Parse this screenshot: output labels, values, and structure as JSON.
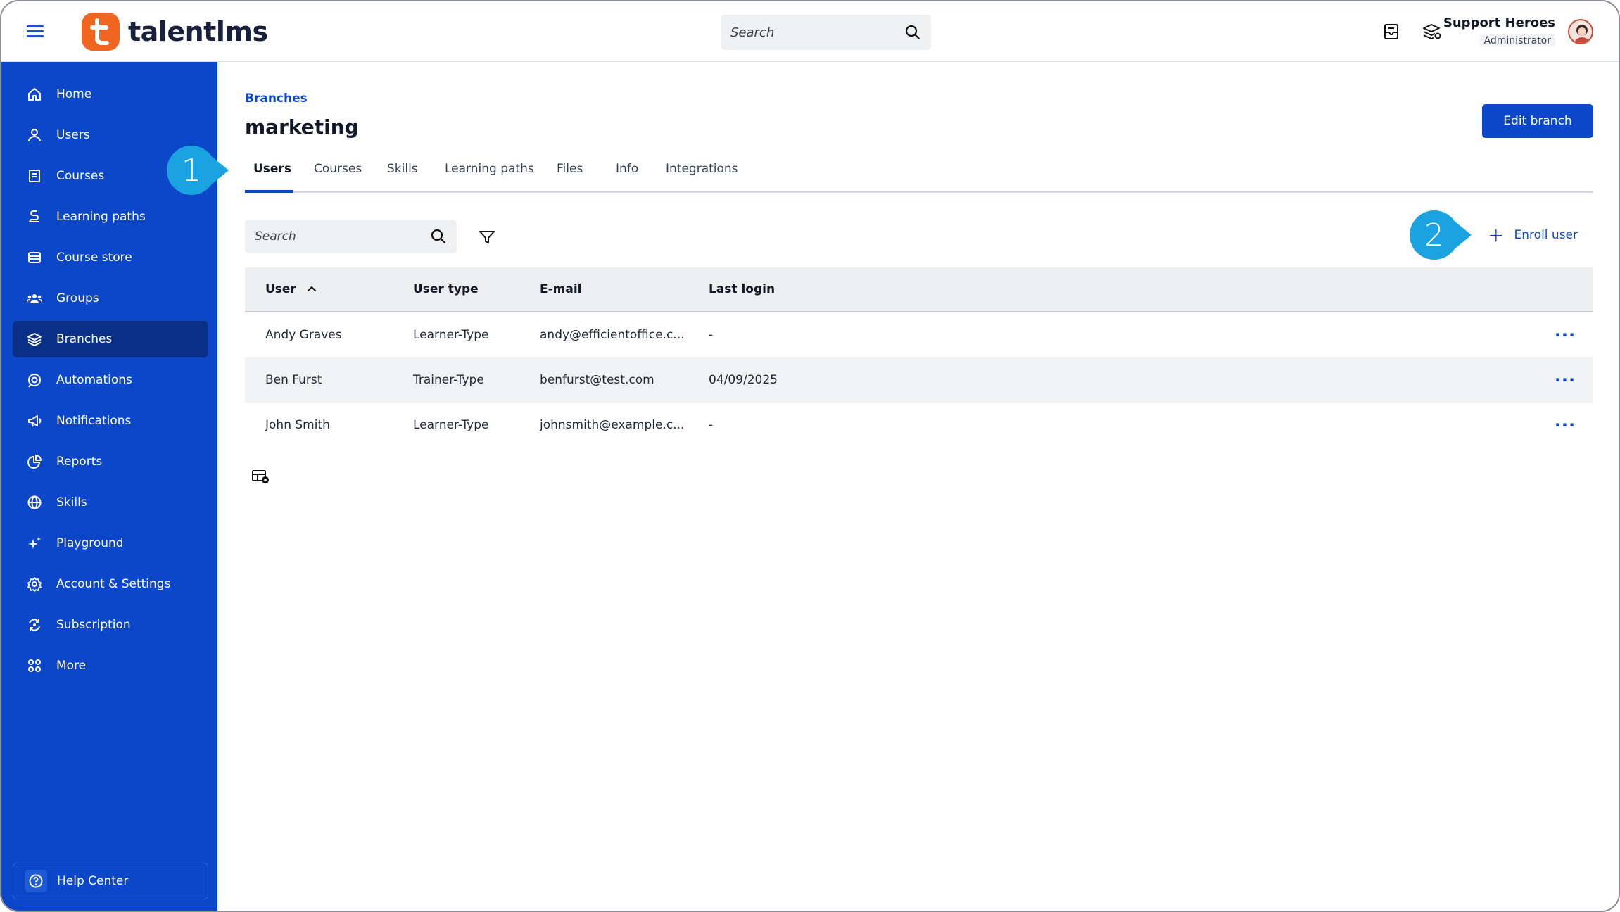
{
  "app": {
    "brand_name": "talentlms",
    "brand_color": "#f0651f",
    "accent_color": "#0d47c9"
  },
  "topbar": {
    "search_placeholder": "Search",
    "icons": [
      "menu-icon",
      "search-icon",
      "messages-icon",
      "branches-switch-icon"
    ],
    "user_name": "Support Heroes",
    "user_role": "Administrator"
  },
  "sidebar": {
    "items": [
      {
        "label": "Home",
        "icon": "home-icon"
      },
      {
        "label": "Users",
        "icon": "user-icon"
      },
      {
        "label": "Courses",
        "icon": "book-icon"
      },
      {
        "label": "Learning paths",
        "icon": "path-icon"
      },
      {
        "label": "Course store",
        "icon": "store-icon"
      },
      {
        "label": "Groups",
        "icon": "groups-icon"
      },
      {
        "label": "Branches",
        "icon": "layers-icon",
        "active": true
      },
      {
        "label": "Automations",
        "icon": "automation-icon"
      },
      {
        "label": "Notifications",
        "icon": "megaphone-icon"
      },
      {
        "label": "Reports",
        "icon": "pie-chart-icon"
      },
      {
        "label": "Skills",
        "icon": "globe-icon"
      },
      {
        "label": "Playground",
        "icon": "sparkle-icon"
      },
      {
        "label": "Account & Settings",
        "icon": "gear-icon"
      },
      {
        "label": "Subscription",
        "icon": "refresh-icon"
      },
      {
        "label": "More",
        "icon": "grid-icon"
      }
    ],
    "help_label": "Help Center"
  },
  "main": {
    "breadcrumb": "Branches",
    "title": "marketing",
    "edit_button": "Edit branch",
    "tabs": [
      "Users",
      "Courses",
      "Skills",
      "Learning paths",
      "Files",
      "Info",
      "Integrations"
    ],
    "active_tab": "Users",
    "search_placeholder": "Search",
    "enroll_label": "Enroll user",
    "callouts": [
      "1",
      "2"
    ],
    "table": {
      "columns": [
        "User",
        "User type",
        "E-mail",
        "Last login"
      ],
      "sort": "User ascending",
      "rows": [
        {
          "user": "Andy Graves",
          "type": "Learner-Type",
          "email": "andy@efficientoffice.c...",
          "last_login": "-"
        },
        {
          "user": "Ben Furst",
          "type": "Trainer-Type",
          "email": "benfurst@test.com",
          "last_login": "04/09/2025"
        },
        {
          "user": "John Smith",
          "type": "Learner-Type",
          "email": "johnsmith@example.c...",
          "last_login": "-"
        }
      ],
      "row_action_label": "···"
    }
  }
}
